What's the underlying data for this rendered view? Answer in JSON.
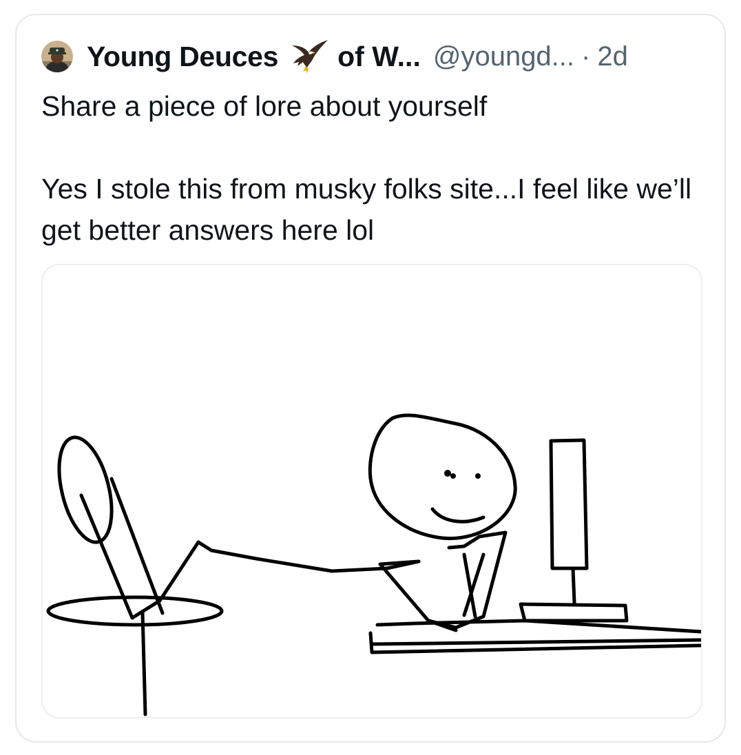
{
  "post": {
    "author": {
      "display_name": "Young Deuces",
      "name_icon": "eagle-icon",
      "name_suffix": "of W...",
      "handle": "@youngd...",
      "separator": "·",
      "timestamp": "2d"
    },
    "text": {
      "line1": "Share a piece of lore about yourself",
      "line2": "Yes I stole this from musky folks site...I feel like we’ll get better answers here lol"
    },
    "media": {
      "type": "image",
      "subject": "stick-figure-at-computer"
    }
  },
  "colors": {
    "text_primary": "#0f1419",
    "text_secondary": "#536471",
    "border": "#e6e8eb",
    "background": "#ffffff"
  }
}
